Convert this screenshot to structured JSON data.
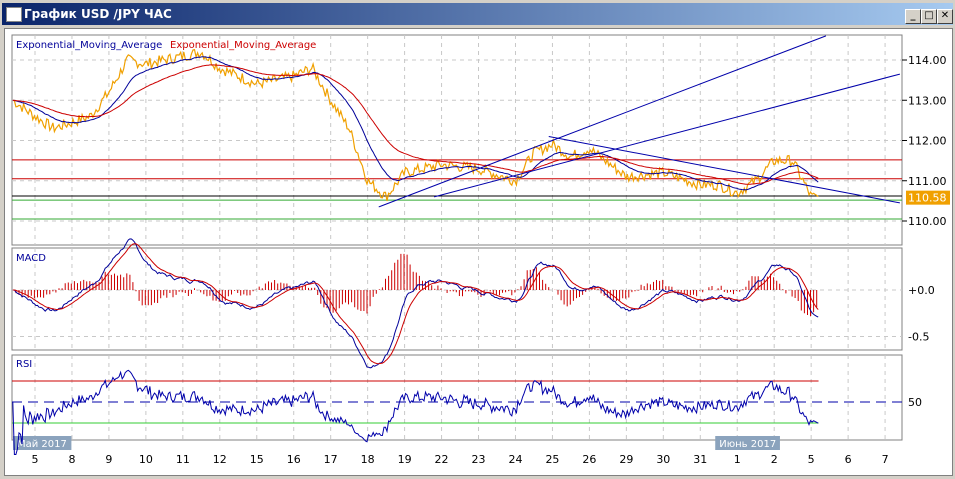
{
  "window": {
    "title": "График USD /JPY  ЧАС",
    "min": "_",
    "max": "□",
    "close": "✕"
  },
  "legend": {
    "ema1": "Exponential_Moving_Average",
    "ema2": "Exponential_Moving_Average"
  },
  "panes": {
    "macd": "MACD",
    "rsi": "RSI"
  },
  "chart_data": {
    "type": "line",
    "title": "USD/JPY hourly",
    "price_axis": {
      "ticks": [
        "114.00",
        "113.00",
        "112.00",
        "111.00",
        "110.00"
      ],
      "range": [
        109.75,
        114.6
      ]
    },
    "current_price": "110.58",
    "x_ticks": [
      "5",
      "8",
      "9",
      "10",
      "11",
      "12",
      "15",
      "16",
      "17",
      "18",
      "19",
      "22",
      "23",
      "24",
      "25",
      "26",
      "29",
      "30",
      "31",
      "1",
      "2",
      "5",
      "6",
      "7"
    ],
    "month_labels": [
      {
        "label": "Май 2017",
        "at": 0
      },
      {
        "label": "Июнь 2017",
        "at": 19
      }
    ],
    "price_keypoints": [
      [
        -0.6,
        113.0
      ],
      [
        0,
        112.6
      ],
      [
        0.5,
        112.3
      ],
      [
        1.5,
        112.6
      ],
      [
        2,
        113.2
      ],
      [
        2.5,
        114.0
      ],
      [
        3,
        113.9
      ],
      [
        4,
        114.1
      ],
      [
        4.5,
        114.2
      ],
      [
        5,
        113.8
      ],
      [
        6,
        113.4
      ],
      [
        7,
        113.6
      ],
      [
        7.5,
        113.8
      ],
      [
        8,
        113.0
      ],
      [
        8.5,
        112.3
      ],
      [
        9,
        111.0
      ],
      [
        9.5,
        110.6
      ],
      [
        10,
        111.2
      ],
      [
        11,
        111.4
      ],
      [
        12,
        111.3
      ],
      [
        13,
        111.0
      ],
      [
        13.5,
        111.7
      ],
      [
        14,
        111.9
      ],
      [
        14.5,
        111.6
      ],
      [
        15,
        111.8
      ],
      [
        16,
        111.1
      ],
      [
        17,
        111.2
      ],
      [
        18,
        110.9
      ],
      [
        18.5,
        110.9
      ],
      [
        19,
        110.7
      ],
      [
        19.5,
        111.0
      ],
      [
        20,
        111.5
      ],
      [
        20.5,
        111.5
      ],
      [
        21,
        110.6
      ],
      [
        21.2,
        110.58
      ]
    ],
    "horizontal_levels": [
      {
        "price": 111.52,
        "color": "#cc0000"
      },
      {
        "price": 111.05,
        "color": "#cc0000"
      },
      {
        "price": 110.62,
        "color": "#000000"
      },
      {
        "price": 110.52,
        "color": "#33aa33"
      },
      {
        "price": 110.05,
        "color": "#33aa33"
      }
    ],
    "trend_lines": [
      [
        [
          9.3,
          110.35
        ],
        [
          21.4,
          114.6
        ]
      ],
      [
        [
          10.8,
          110.6
        ],
        [
          23.4,
          113.65
        ]
      ],
      [
        [
          13.9,
          112.1
        ],
        [
          23.4,
          110.45
        ]
      ]
    ],
    "macd_axis": {
      "ticks": [
        "+0.0",
        "-0.5"
      ],
      "range": [
        -0.6,
        0.45
      ]
    },
    "rsi_axis": {
      "ticks": [
        "50"
      ],
      "levels": [
        70,
        50,
        30
      ],
      "range": [
        15,
        85
      ]
    },
    "colors": {
      "price": "#f0a000",
      "ema_fast": "#000099",
      "ema_slow": "#cc0000",
      "rsi": "#0000aa",
      "rsi_ob": "#cc00cc",
      "rsi_os": "#33cc33"
    }
  }
}
